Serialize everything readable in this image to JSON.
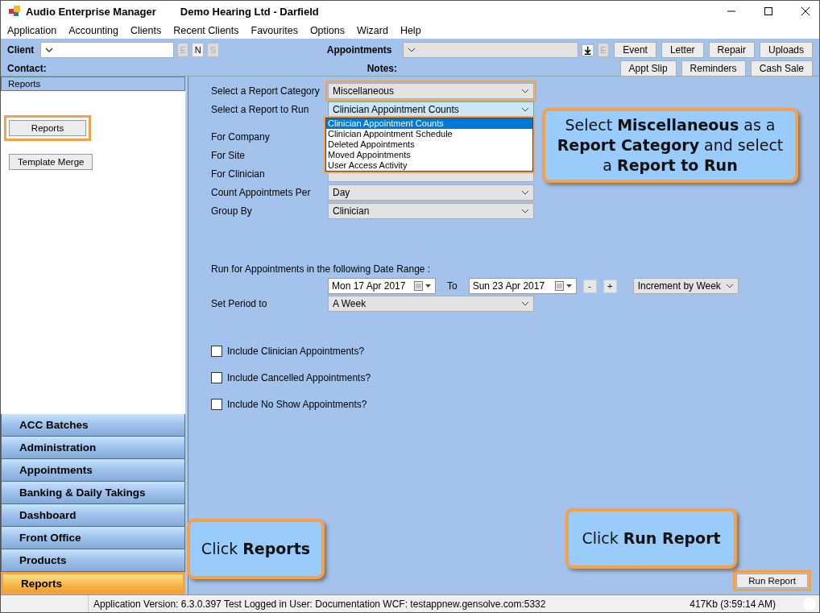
{
  "window": {
    "title": "Audio Enterprise Manager",
    "subtitle": "Demo Hearing Ltd - Darfield"
  },
  "menu": [
    "Application",
    "Accounting",
    "Clients",
    "Recent Clients",
    "Favourites",
    "Options",
    "Wizard",
    "Help"
  ],
  "toolbar": {
    "client_label": "Client",
    "client_buttons": [
      {
        "label": "E",
        "disabled": true
      },
      {
        "label": "N",
        "disabled": false
      },
      {
        "label": "S",
        "disabled": true
      }
    ],
    "appointments_label": "Appointments",
    "appointments_buttons": [
      {
        "label": "E",
        "disabled": true
      }
    ],
    "buttons_row1": [
      "Event",
      "Letter",
      "Repair",
      "Uploads"
    ],
    "contact_label": "Contact:",
    "notes_label": "Notes:",
    "buttons_row2": [
      "Appt Slip",
      "Reminders",
      "Cash Sale"
    ]
  },
  "sidebar": {
    "header": "Reports",
    "buttons": [
      {
        "label": "Reports",
        "highlighted": true
      },
      {
        "label": "Template Merge",
        "highlighted": false
      }
    ],
    "nav": [
      {
        "label": "ACC Batches",
        "selected": false
      },
      {
        "label": "Administration",
        "selected": false
      },
      {
        "label": "Appointments",
        "selected": false
      },
      {
        "label": "Banking & Daily Takings",
        "selected": false
      },
      {
        "label": "Dashboard",
        "selected": false
      },
      {
        "label": "Front Office",
        "selected": false
      },
      {
        "label": "Products",
        "selected": false
      },
      {
        "label": "Reports",
        "selected": true
      }
    ]
  },
  "form": {
    "rows": [
      {
        "label": "Select a Report Category",
        "value": "Miscellaneous",
        "highlighted": true
      },
      {
        "label": "Select a Report to Run",
        "value": "Clinician Appointment Counts",
        "highlighted": false
      },
      {
        "label": "For Company"
      },
      {
        "label": "For Site"
      },
      {
        "label": "For Clinician"
      },
      {
        "label": "Count Appointmets Per",
        "value": "Day",
        "highlighted": false
      },
      {
        "label": "Group By",
        "value": "Clinician",
        "highlighted": false
      }
    ],
    "dropdown": [
      {
        "label": "Clinician Appointment Counts",
        "selected": true
      },
      {
        "label": "Clinician Appointment Schedule",
        "selected": false
      },
      {
        "label": "Deleted Appointments",
        "selected": false
      },
      {
        "label": "Moved Appointments",
        "selected": false
      },
      {
        "label": "User Access Activity",
        "selected": false
      }
    ],
    "date_range_label": "Run for Appointments in the following Date Range :",
    "date_from": "Mon 17 Apr 2017",
    "to_label": "To",
    "date_to": "Sun 23 Apr 2017",
    "step_buttons": [
      "-",
      "+"
    ],
    "increment": "Increment by Week",
    "period_label": "Set Period to",
    "period": "A Week",
    "checkboxes": [
      {
        "label": "Include Clinician Appointments?",
        "checked": false
      },
      {
        "label": "Include Cancelled Appointments?",
        "checked": false
      },
      {
        "label": "Include No Show Appointments?",
        "checked": false
      }
    ],
    "run_button": {
      "label": "Run Report",
      "highlighted": true
    }
  },
  "callouts": [
    {
      "text": "Select **Miscellaneous** as a **Report Category** and select a **Report to Run**"
    },
    {
      "text": "Click **Reports**"
    },
    {
      "text": "Click **Run Report**"
    }
  ],
  "status_bar": {
    "version": "Application Version: 6.3.0.397 Test  Logged in User: Documentation WCF: testappnew.gensolve.com:5332",
    "memory": "417Kb  (3:59:14 AM)"
  }
}
